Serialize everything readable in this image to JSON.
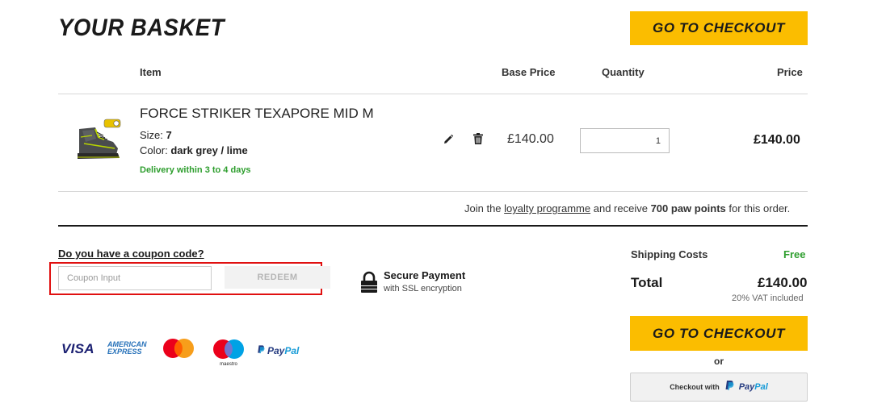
{
  "header": {
    "title": "YOUR BASKET",
    "checkout_label": "GO TO CHECKOUT"
  },
  "table": {
    "columns": [
      "Item",
      "Base Price",
      "Quantity",
      "Price"
    ]
  },
  "item": {
    "name": "FORCE STRIKER TEXAPORE MID M",
    "size_label": "Size:",
    "size_value": "7",
    "color_label": "Color:",
    "color_value": "dark grey / lime",
    "delivery": "Delivery within 3 to 4 days",
    "base_price": "£140.00",
    "quantity": "1",
    "price": "£140.00",
    "image_icon": "hiking-boot-image"
  },
  "loyalty": {
    "prefix": "Join the",
    "link": "loyalty programme",
    "middle": "and receive",
    "points": "700 paw points",
    "suffix": "for this order."
  },
  "coupon": {
    "question": "Do you have a coupon code?",
    "placeholder": "Coupon Input",
    "redeem_label": "REDEEM"
  },
  "secure": {
    "title": "Secure Payment",
    "subtitle": "with SSL encryption",
    "icon": "lock-icon"
  },
  "summary": {
    "shipping_label": "Shipping Costs",
    "shipping_value": "Free",
    "total_label": "Total",
    "total_value": "£140.00",
    "vat_note": "20% VAT included",
    "checkout_label": "GO TO CHECKOUT",
    "or_label": "or",
    "paypal_prefix": "Checkout with"
  },
  "payment_methods": {
    "visa": "VISA",
    "amex_line1": "AMERICAN",
    "amex_line2": "EXPRESS",
    "maestro": "maestro",
    "paypal_p1": "Pay",
    "paypal_p2": "Pal"
  },
  "colors": {
    "accent_yellow": "#fbbd00",
    "delivery_green": "#2e9e2e",
    "highlight_red": "#e01010"
  }
}
